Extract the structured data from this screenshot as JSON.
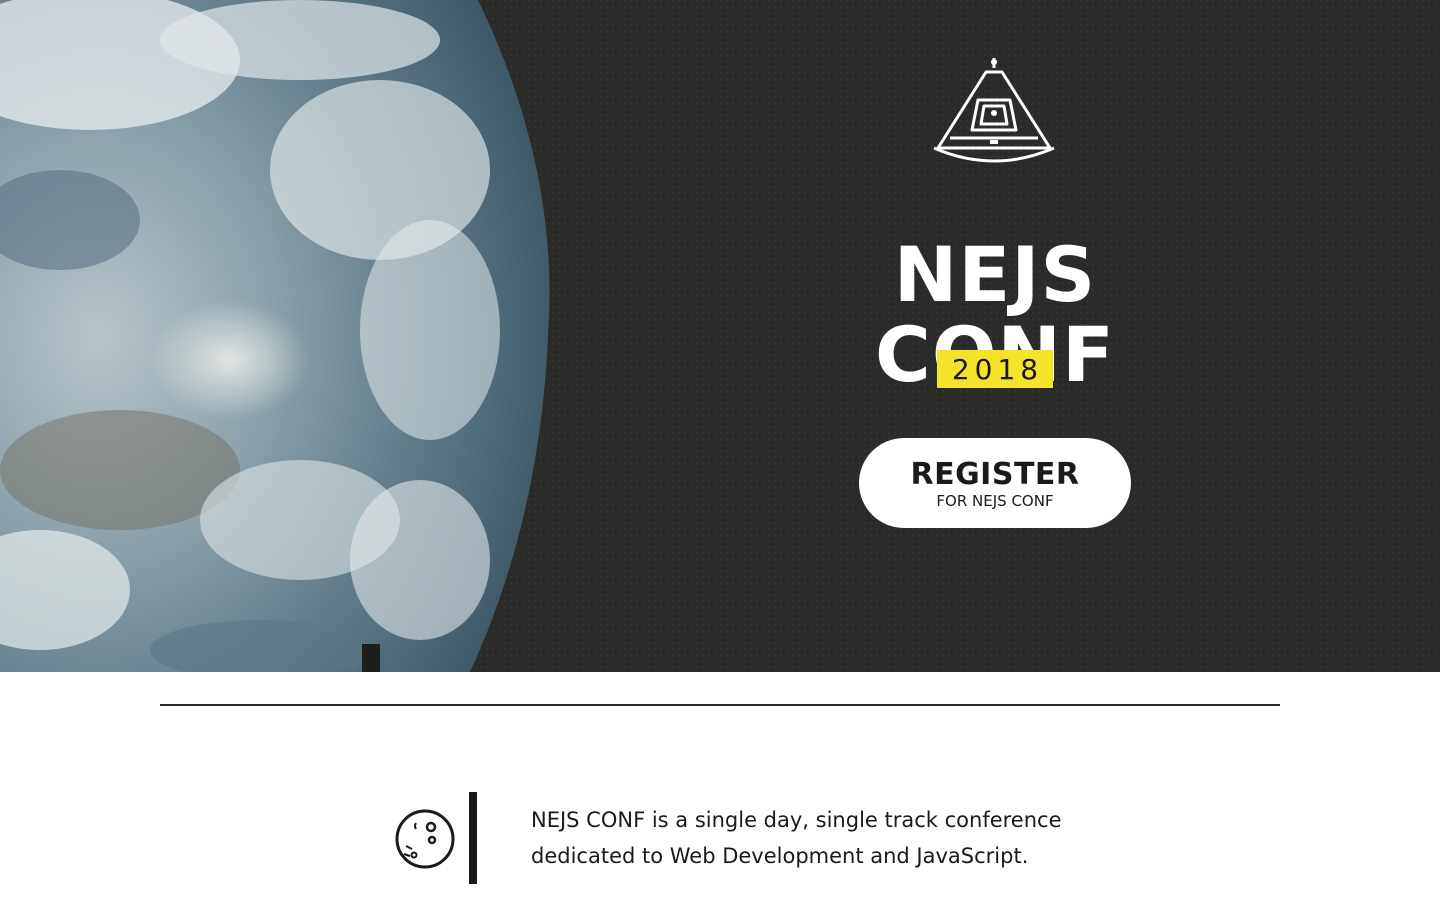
{
  "hero": {
    "title_line1": "NEJS",
    "title_line2": "CONF",
    "year": "2018",
    "register_label": "REGISTER",
    "register_sublabel": "FOR NEJS CONF",
    "background_image": "earth-from-space",
    "logo_icon": "space-capsule-icon"
  },
  "about": {
    "icon": "moon-icon",
    "text": "NEJS CONF is a single day, single track conference dedicated to Web Development and JavaScript."
  },
  "colors": {
    "hero_bg": "#2a2a28",
    "accent_yellow": "#f5e22a",
    "text_dark": "#1a1a1a",
    "white": "#ffffff"
  }
}
